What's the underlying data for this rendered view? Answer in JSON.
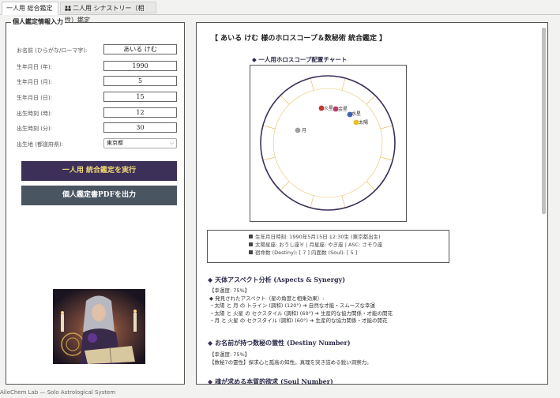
{
  "tabs": [
    {
      "label": "一人用 総合鑑定",
      "active": true
    },
    {
      "label": "二人用 シナストリー（相性）鑑定",
      "active": false
    }
  ],
  "form": {
    "legend": "個人鑑定情報入力",
    "fields": [
      {
        "label": "お名前 (ひらがな/ローマ字):",
        "value": "あいる けむ"
      },
      {
        "label": "生年月日 (年):",
        "value": "1990"
      },
      {
        "label": "生年月日 (月):",
        "value": "5"
      },
      {
        "label": "生年月日 (日):",
        "value": "15"
      },
      {
        "label": "出生時刻 (時):",
        "value": "12"
      },
      {
        "label": "出生時刻 (分):",
        "value": "30"
      }
    ],
    "prefecture_label": "出生地 (都道府県):",
    "prefecture_value": "東京都",
    "run_button": "一人用 統合鑑定を実行",
    "pdf_button": "個人鑑定書PDFを出力"
  },
  "report": {
    "title": "【 あいる けむ 様のホロスコープ＆数秘術 統合鑑定 】",
    "chart_label": "◆ 一人用ホロスコープ配置チャート",
    "planets": [
      {
        "name": "火星",
        "color": "#c0392b"
      },
      {
        "name": "金星",
        "color": "#c0396b"
      },
      {
        "name": "水星",
        "color": "#3a64b0"
      },
      {
        "name": "太陽",
        "color": "#e6c020"
      },
      {
        "name": "月",
        "color": "#a0a0a0"
      }
    ],
    "info_lines": [
      "生年月日時刻: 1990年5月15日 12:30生 (東京都出生)",
      "太陽星座: おうし座♉  |  月星座: やぎ座  |  ASC: さそり座",
      "宿命数 (Destiny): [ 7 ]  内面数 (Soul): [ 5 ]"
    ],
    "sections": [
      {
        "title": "天体アスペクト分析 (Aspects & Synergy)",
        "lines": [
          "【幸運度: 75%】",
          "◆ 発見されたアスペクト（星の角度と相乗効果）:",
          "・太陽 と 月 の トライン (調和) (120°) ➔ 自然な才能・スムーズな幸運",
          "・太陽 と 火星 の セクスタイル (調和) (60°) ➔ 生産的な協力関係・才能の開花",
          "・月 と 火星 の セクスタイル (調和) (60°) ➔ 生産的な協力関係・才能の開花"
        ]
      },
      {
        "title": "お名前が持つ数秘の霊性 (Destiny Number)",
        "lines": [
          "【幸運度: 75%】",
          "【数秘7の霊性】探求心と孤高の知性。真理を突き詰める鋭い洞察力。"
        ]
      },
      {
        "title": "魂が求める本質的欲求 (Soul Number)",
        "lines": []
      }
    ]
  },
  "footer": "AileChem Lab — Solo Astrological System"
}
